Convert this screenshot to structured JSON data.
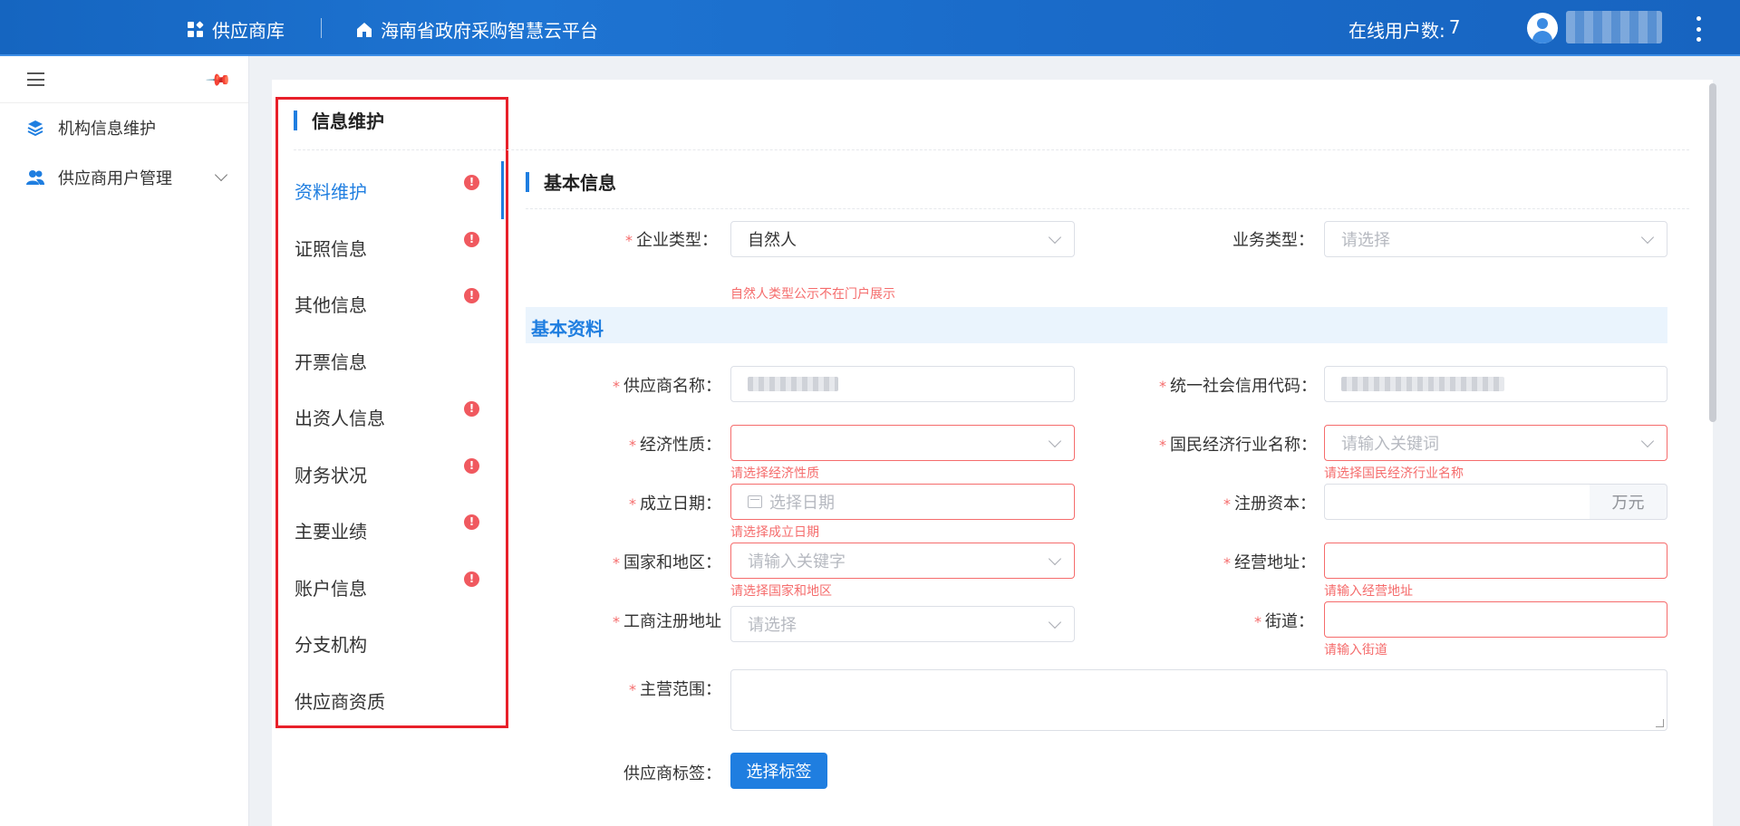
{
  "header": {
    "brand": "供应商库",
    "platform": "海南省政府采购智慧云平台",
    "online_label": "在线用户数:",
    "online_count": "7"
  },
  "sidebar": {
    "items": [
      {
        "label": "机构信息维护",
        "icon": "layers-icon"
      },
      {
        "label": "供应商用户管理",
        "icon": "users-icon"
      }
    ]
  },
  "info_nav": {
    "title": "信息维护",
    "items": [
      {
        "label": "资料维护",
        "warning": true,
        "active": true
      },
      {
        "label": "证照信息",
        "warning": true
      },
      {
        "label": "其他信息",
        "warning": true
      },
      {
        "label": "开票信息",
        "warning": false
      },
      {
        "label": "出资人信息",
        "warning": true
      },
      {
        "label": "财务状况",
        "warning": true
      },
      {
        "label": "主要业绩",
        "warning": true
      },
      {
        "label": "账户信息",
        "warning": true
      },
      {
        "label": "分支机构",
        "warning": false
      },
      {
        "label": "供应商资质",
        "warning": false
      }
    ],
    "warning_glyph": "!"
  },
  "section": {
    "title": "基本信息",
    "band_title": "基本资料"
  },
  "form": {
    "enterprise_type": {
      "label": "企业类型",
      "value": "自然人",
      "note": "自然人类型公示不在门户展示"
    },
    "business_type": {
      "label": "业务类型",
      "placeholder": "请选择"
    },
    "supplier_name": {
      "label": "供应商名称"
    },
    "credit_code": {
      "label": "统一社会信用代码"
    },
    "economic_nature": {
      "label": "经济性质",
      "error": "请选择经济性质"
    },
    "industry_name": {
      "label": "国民经济行业名称",
      "placeholder": "请输入关键词",
      "error": "请选择国民经济行业名称"
    },
    "found_date": {
      "label": "成立日期",
      "placeholder": "选择日期",
      "error": "请选择成立日期"
    },
    "registered_capital": {
      "label": "注册资本",
      "unit": "万元"
    },
    "country_region": {
      "label": "国家和地区",
      "placeholder": "请输入关键字",
      "error": "请选择国家和地区"
    },
    "business_address": {
      "label": "经营地址",
      "error": "请输入经营地址"
    },
    "reg_address": {
      "label": "工商注册地址",
      "placeholder": "请选择"
    },
    "street": {
      "label": "街道",
      "error": "请输入街道"
    },
    "main_scope": {
      "label": "主营范围"
    },
    "supplier_tag": {
      "label": "供应商标签",
      "button": "选择标签"
    }
  },
  "colors": {
    "primary": "#1f7ee0",
    "error": "#f56c6c",
    "highlight_border": "#e8202a"
  }
}
